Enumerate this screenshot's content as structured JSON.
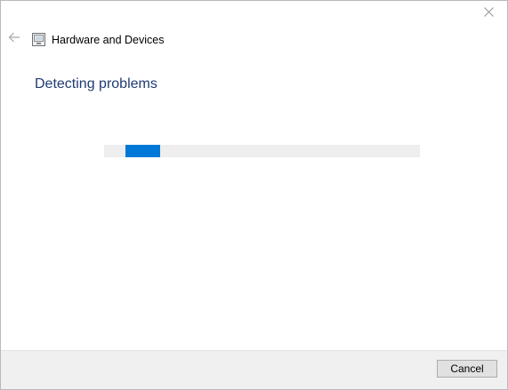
{
  "window": {
    "title": "Hardware and Devices",
    "icons": {
      "close": "close-icon",
      "back": "back-arrow-icon",
      "app": "troubleshooter-icon"
    }
  },
  "main": {
    "heading": "Detecting problems",
    "progress": {
      "state": "indeterminate",
      "chunk_color": "#0078d7",
      "track_color": "#eeeeee"
    }
  },
  "footer": {
    "cancel_label": "Cancel"
  },
  "colors": {
    "heading": "#1f3b73",
    "accent": "#0078d7"
  }
}
